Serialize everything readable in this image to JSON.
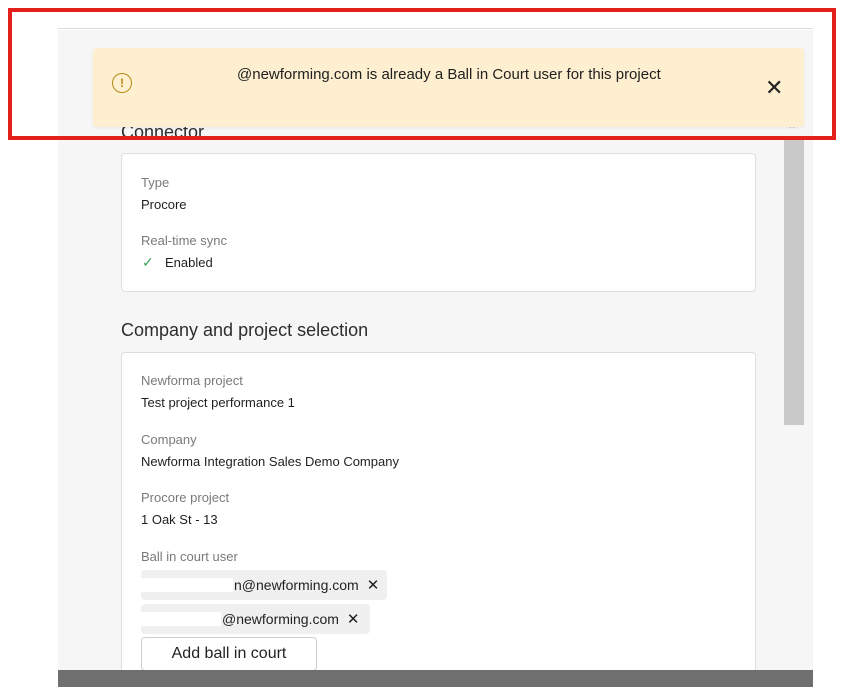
{
  "toast": {
    "email_suffix": "@newforming.com",
    "message": " is already a Ball in Court user for this project",
    "icon": "warning-circle-icon",
    "close_icon": "close-icon"
  },
  "connector": {
    "title": "Connector",
    "type_label": "Type",
    "type_value": "Procore",
    "sync_label": "Real-time sync",
    "sync_value": "Enabled"
  },
  "selection": {
    "title": "Company and project selection",
    "project_label": "Newforma project",
    "project_value": "Test project performance 1",
    "company_label": "Company",
    "company_value": "Newforma Integration Sales Demo Company",
    "procore_label": "Procore project",
    "procore_value": "1 Oak St - 13",
    "bic_label": "Ball in court user",
    "bic_users": [
      "n@newforming.com",
      "@newforming.com"
    ],
    "add_button": "Add ball in court"
  },
  "colors": {
    "toast_bg": "#fdefcf",
    "warning": "#b58a14",
    "success": "#3aa55d",
    "highlight": "#e3201b"
  }
}
